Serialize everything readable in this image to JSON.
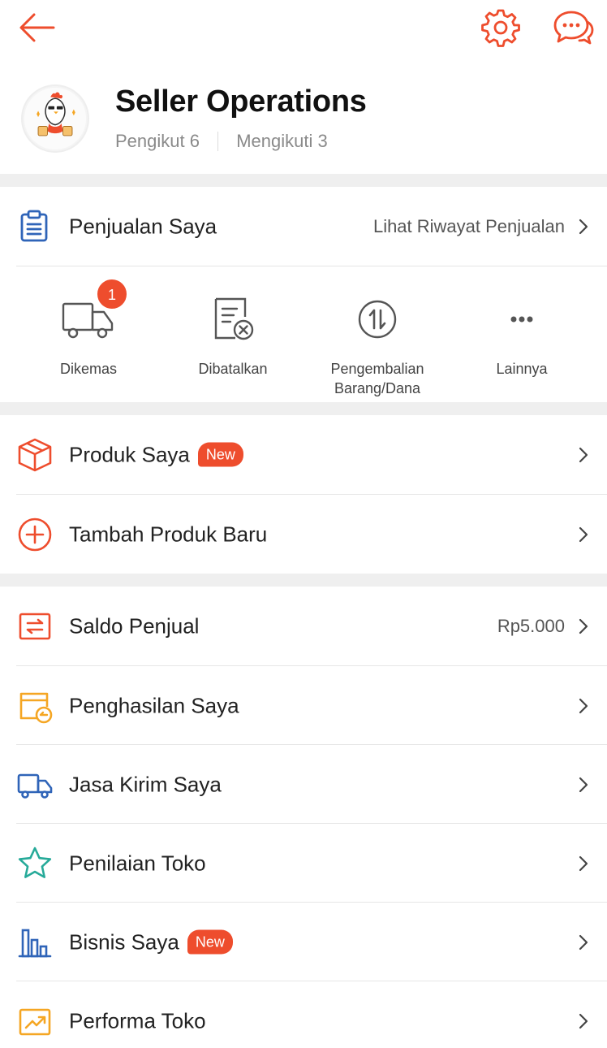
{
  "header": {
    "back_icon": "arrow-left-icon",
    "settings_icon": "gear-icon",
    "chat_icon": "chat-bubbles-icon",
    "accent_color": "#ee4d2d"
  },
  "profile": {
    "shop_name": "Seller Operations",
    "followers_label": "Pengikut 6",
    "following_label": "Mengikuti 3"
  },
  "sales": {
    "title": "Penjualan Saya",
    "history_link": "Lihat Riwayat Penjualan",
    "statuses": [
      {
        "label": "Dikemas",
        "icon": "truck-icon",
        "badge": "1"
      },
      {
        "label": "Dibatalkan",
        "icon": "cancelled-doc-icon"
      },
      {
        "label": "Pengembalian Barang/Dana",
        "icon": "return-arrows-icon"
      },
      {
        "label": "Lainnya",
        "icon": "more-dots-icon"
      }
    ]
  },
  "products": {
    "items": [
      {
        "label": "Produk Saya",
        "badge": "New",
        "icon": "box-icon"
      },
      {
        "label": "Tambah Produk Baru",
        "icon": "plus-circle-icon"
      }
    ]
  },
  "finance": {
    "items": [
      {
        "label": "Saldo Penjual",
        "value": "Rp5.000",
        "icon": "balance-icon"
      },
      {
        "label": "Penghasilan Saya",
        "icon": "income-icon"
      },
      {
        "label": "Jasa Kirim Saya",
        "icon": "truck-icon"
      },
      {
        "label": "Penilaian Toko",
        "icon": "star-icon"
      },
      {
        "label": "Bisnis Saya",
        "badge": "New",
        "icon": "bar-chart-icon"
      },
      {
        "label": "Performa Toko",
        "icon": "trend-chart-icon"
      }
    ]
  }
}
